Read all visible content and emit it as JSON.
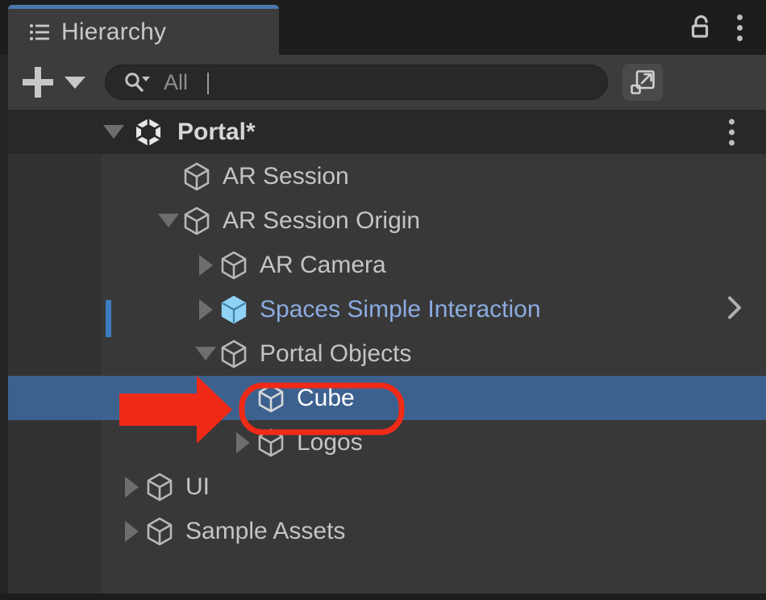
{
  "window": {
    "panel_title": "Hierarchy",
    "panel_icon": "hierarchy-list-icon",
    "lock_icon": "unlocked-padlock-icon",
    "menu_icon": "kebab-menu-icon",
    "accent_color": "#4a78ad",
    "panel_bg": "#383838",
    "gutter_bg": "#323232",
    "tab_bg": "#3c3c3c"
  },
  "toolbar": {
    "create_label": "+",
    "create_icon": "plus-icon",
    "create_dropdown_icon": "caret-down-icon",
    "search": {
      "icon": "search-dropdown-icon",
      "value": "",
      "placeholder": "All"
    },
    "detach_icon": "open-in-new-window-icon"
  },
  "tree": {
    "scene": {
      "name": "Portal*",
      "icon": "unity-scene-icon",
      "expanded": true,
      "menu_icon": "kebab-menu-icon"
    },
    "items": [
      {
        "name": "AR Session",
        "icon": "gameobject-cube-icon",
        "depth": 1,
        "twisty": "none",
        "type": "gameobject",
        "selected": false
      },
      {
        "name": "AR Session Origin",
        "icon": "gameobject-cube-icon",
        "depth": 1,
        "twisty": "expanded",
        "type": "gameobject",
        "selected": false
      },
      {
        "name": "AR Camera",
        "icon": "gameobject-cube-icon",
        "depth": 2,
        "twisty": "collapsed",
        "type": "gameobject",
        "selected": false
      },
      {
        "name": "Spaces Simple Interaction",
        "icon": "prefab-cube-icon",
        "depth": 2,
        "twisty": "collapsed",
        "type": "prefab",
        "selected": false,
        "open_prefab_icon": "chevron-right-icon"
      },
      {
        "name": "Portal Objects",
        "icon": "gameobject-cube-icon",
        "depth": 2,
        "twisty": "expanded",
        "type": "gameobject",
        "selected": false
      },
      {
        "name": "Cube",
        "icon": "gameobject-cube-icon",
        "depth": 3,
        "twisty": "none",
        "type": "gameobject",
        "selected": true
      },
      {
        "name": "Logos",
        "icon": "gameobject-cube-icon",
        "depth": 3,
        "twisty": "collapsed",
        "type": "gameobject",
        "selected": false
      },
      {
        "name": "UI",
        "icon": "gameobject-cube-icon",
        "depth": 1,
        "twisty": "collapsed",
        "type": "gameobject",
        "selected": false
      },
      {
        "name": "Sample Assets",
        "icon": "gameobject-cube-icon",
        "depth": 1,
        "twisty": "collapsed",
        "type": "gameobject",
        "selected": false
      }
    ],
    "selection_color": "#3d618f",
    "prefab_text_color": "#8babe0",
    "drop_marker_color": "#3a7ebf"
  },
  "annotations": {
    "arrow": {
      "icon": "red-arrow-pointer",
      "color": "#f02a17",
      "points_to": "Cube"
    },
    "highlight_box": {
      "icon": "red-rounded-outline",
      "color": "#f02a17",
      "surrounds": "Cube"
    }
  }
}
